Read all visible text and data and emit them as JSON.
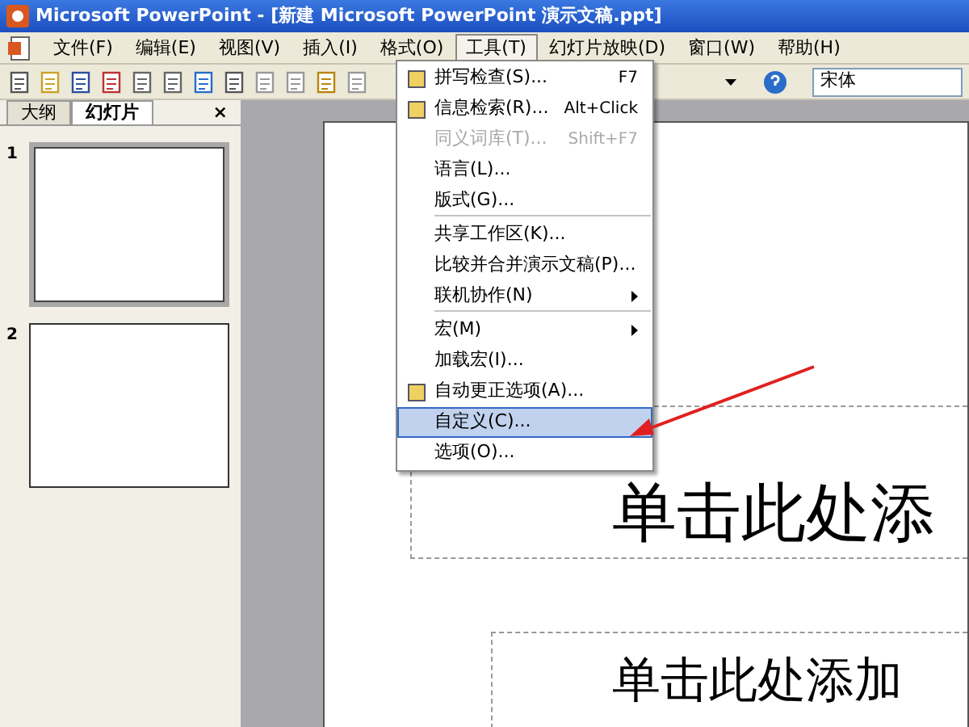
{
  "window": {
    "title": "Microsoft PowerPoint - [新建 Microsoft PowerPoint 演示文稿.ppt]"
  },
  "menu_bar": [
    {
      "label": "文件(F)",
      "selected": false
    },
    {
      "label": "编辑(E)",
      "selected": false
    },
    {
      "label": "视图(V)",
      "selected": false
    },
    {
      "label": "插入(I)",
      "selected": false
    },
    {
      "label": "格式(O)",
      "selected": false
    },
    {
      "label": "工具(T)",
      "selected": true
    },
    {
      "label": "幻灯片放映(D)",
      "selected": false
    },
    {
      "label": "窗口(W)",
      "selected": false
    },
    {
      "label": "帮助(H)",
      "selected": false
    }
  ],
  "toolbar": {
    "font_field": "宋体"
  },
  "panel": {
    "tabs": [
      {
        "label": "大纲",
        "selected": false
      },
      {
        "label": "幻灯片",
        "selected": true
      }
    ],
    "close": "×",
    "slides": [
      {
        "number": "1",
        "selected": true
      },
      {
        "number": "2",
        "selected": false
      }
    ]
  },
  "tools_menu": [
    {
      "label": "拼写检查(S)...",
      "shortcut": "F7",
      "has_icon": true,
      "disabled": false,
      "selected": false,
      "submenu": false,
      "divider_after": false
    },
    {
      "label": "信息检索(R)...",
      "shortcut": "Alt+Click",
      "has_icon": true,
      "disabled": false,
      "selected": false,
      "submenu": false,
      "divider_after": false
    },
    {
      "label": "同义词库(T)...",
      "shortcut": "Shift+F7",
      "has_icon": false,
      "disabled": true,
      "selected": false,
      "submenu": false,
      "divider_after": false
    },
    {
      "label": "语言(L)...",
      "has_icon": false,
      "disabled": false,
      "selected": false,
      "submenu": false,
      "divider_after": false
    },
    {
      "label": "版式(G)...",
      "has_icon": false,
      "disabled": false,
      "selected": false,
      "submenu": false,
      "divider_after": true
    },
    {
      "label": "共享工作区(K)...",
      "has_icon": false,
      "disabled": false,
      "selected": false,
      "submenu": false,
      "divider_after": false
    },
    {
      "label": "比较并合并演示文稿(P)...",
      "has_icon": false,
      "disabled": false,
      "selected": false,
      "submenu": false,
      "divider_after": false
    },
    {
      "label": "联机协作(N)",
      "has_icon": false,
      "disabled": false,
      "selected": false,
      "submenu": true,
      "divider_after": true
    },
    {
      "label": "宏(M)",
      "has_icon": false,
      "disabled": false,
      "selected": false,
      "submenu": true,
      "divider_after": false
    },
    {
      "label": "加载宏(I)...",
      "has_icon": false,
      "disabled": false,
      "selected": false,
      "submenu": false,
      "divider_after": false
    },
    {
      "label": "自动更正选项(A)...",
      "has_icon": true,
      "disabled": false,
      "selected": false,
      "submenu": false,
      "divider_after": false
    },
    {
      "label": "自定义(C)...",
      "has_icon": false,
      "disabled": false,
      "selected": true,
      "submenu": false,
      "divider_after": false
    },
    {
      "label": "选项(O)...",
      "has_icon": false,
      "disabled": false,
      "selected": false,
      "submenu": false,
      "divider_after": false
    }
  ],
  "slide": {
    "title_placeholder": "单击此处添",
    "subtitle_placeholder": "单击此处添加"
  }
}
